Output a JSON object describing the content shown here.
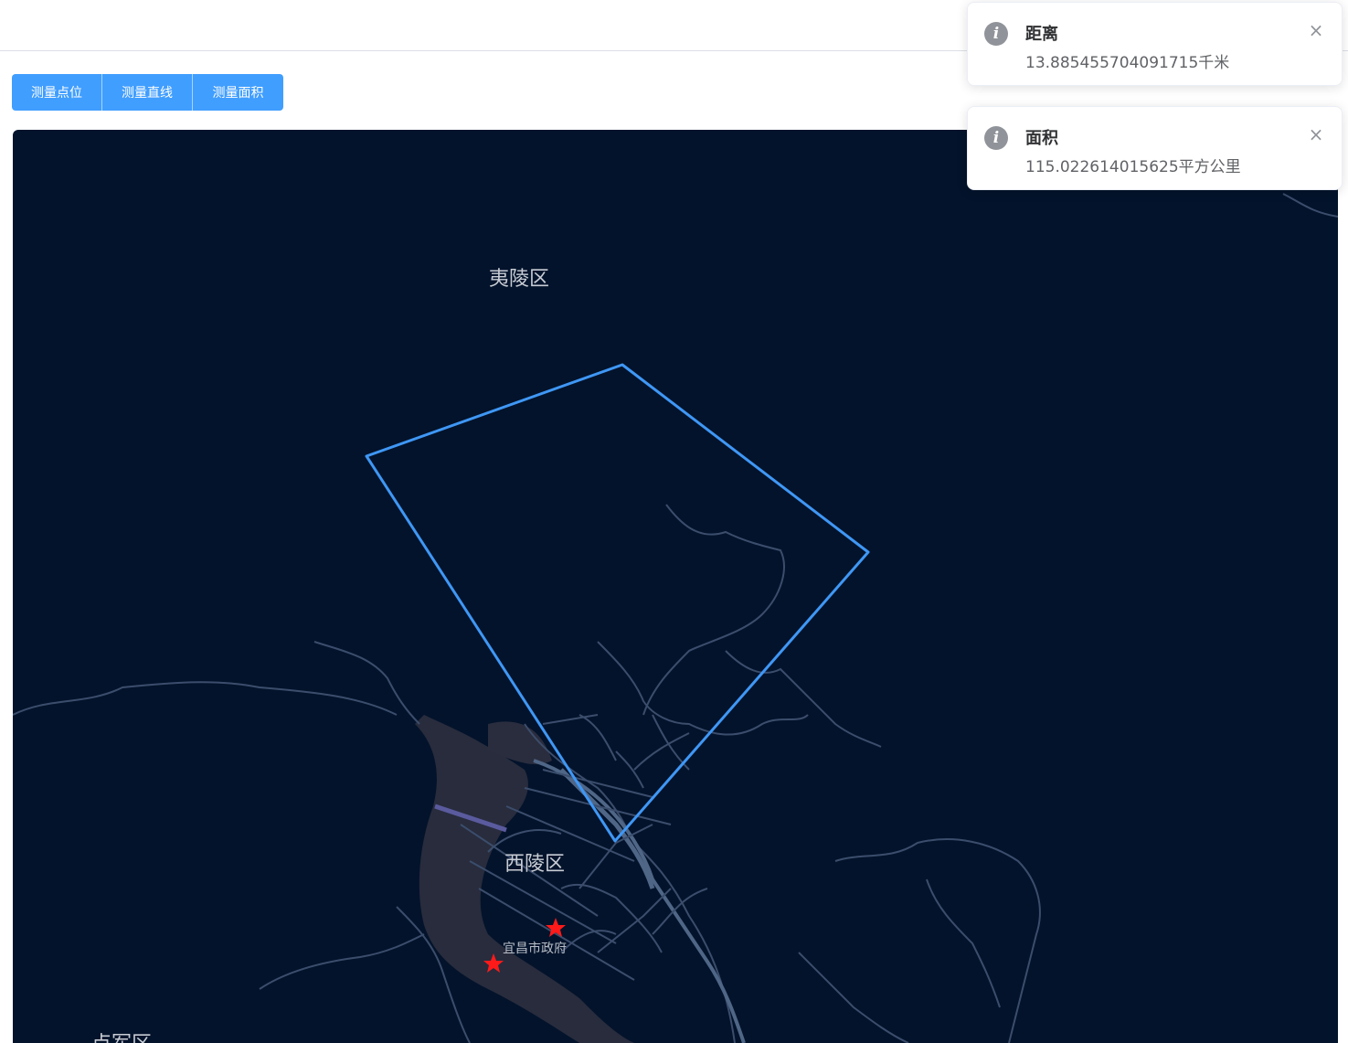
{
  "toolbar": {
    "buttons": [
      "测量点位",
      "测量直线",
      "测量面积"
    ]
  },
  "map": {
    "districts": {
      "yiling": "夷陵区",
      "xiling": "西陵区",
      "dianjun": "点军区"
    },
    "poi": {
      "label": "宜昌市政府"
    },
    "colors": {
      "background": "#03132b",
      "roads": "#3b4d6c",
      "river": "#2a2d3e",
      "polygon": "#3f97f5",
      "marker": "#ff1a1a"
    }
  },
  "notifications": [
    {
      "icon": "info-icon",
      "title": "距离",
      "message": "13.885455704091715千米"
    },
    {
      "icon": "info-icon",
      "title": "面积",
      "message": "115.022614015625平方公里"
    }
  ],
  "close_glyph": "×"
}
